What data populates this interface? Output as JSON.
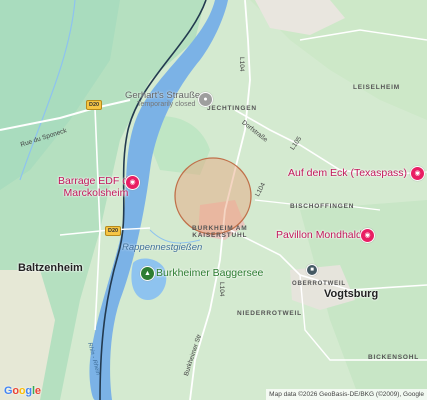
{
  "map": {
    "places": {
      "jechtingen": "JECHTINGEN",
      "leiselheim": "LEISELHEIM",
      "bischoffingen": "BISCHOFFINGEN",
      "burkheim": "BURKHEIM AM\nKAISERSTUHL",
      "oberrotweil": "OBERROTWEIL",
      "niederrotweil": "NIEDERROTWEIL",
      "bickensohl": "BICKENSOHL",
      "baltzenheim": "Baltzenheim",
      "vogtsburg": "Vogtsburg"
    },
    "roads": {
      "l104a": "L104",
      "l104b": "L104",
      "l104c": "L104",
      "l105": "L105",
      "dorfstrasse": "Dorfstraße",
      "rue_du_sponeck": "Rue du Sponeck",
      "burkheimer_str": "Burkheimer Str",
      "d20_top": "D20",
      "d20_bottom": "D20"
    },
    "pois": {
      "gerharts_name": "Gerhart's Strauße",
      "gerharts_status": "Temporarily closed",
      "auf_dem_eck": "Auf dem Eck (Texaspass)",
      "barrage": "Barrage EDF de\nMarckolsheim",
      "pavillon": "Pavillon Mondhalde",
      "baggersee": "Burkheimer Baggersee",
      "rappennestgiessen": "Rappennestgießen",
      "rhine_label": "Rhin - Rhein"
    },
    "icons": {
      "restaurant": "restaurant-icon",
      "camera": "camera-icon",
      "park": "park-icon",
      "train": "train-station-icon"
    },
    "colors": {
      "land": "#d4ead0",
      "forest": "#bfe3c2",
      "river": "#7bb2e6",
      "circle_stroke": "#c0704a",
      "circle_fill": "#e8a27a",
      "poi_pink": "#c2185b",
      "poi_green": "#2e7d32"
    },
    "attribution": "Map data ©2026 GeoBasis-DE/BKG (©2009), Google",
    "logo": "Google"
  }
}
